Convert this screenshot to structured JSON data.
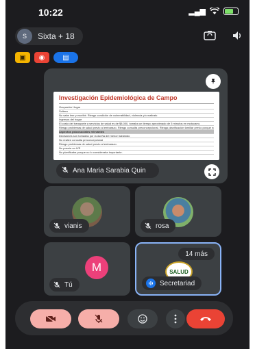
{
  "status_bar": {
    "time": "10:22",
    "signal": "▂▄▆",
    "wifi": "wifi",
    "battery_level": 0.6
  },
  "call": {
    "title": "Sixta + 18",
    "avatar_text": "S"
  },
  "presentation": {
    "doc_title": "Investigación Epidemiológica de Campo",
    "doc_lines": [
      {
        "text": "Ocupación Hogar",
        "highlight": false
      },
      {
        "text": "Soltera",
        "highlight": false
      },
      {
        "text": "No sabe leer y escribir. Riesgo condición de vulnerabilidad, violencia y/o maltrato",
        "highlight": false
      },
      {
        "text": "Ingresos del hogar",
        "highlight": false
      },
      {
        "text": "El costo del transporte a servicios de salud es de $8.000, tomaba un tiempo aproximado de 5 minutos en motocarro.",
        "highlight": false
      },
      {
        "text": "Riesgo problemas de salud previo al embarazo. Riesgo consulta preconcepcional. Riesgo planificación familiar previo porque no lo consideraba importante.",
        "highlight": false
      },
      {
        "text": "Aspectos psicosociales relevantes",
        "highlight": true
      },
      {
        "text": "Decisiones son tomadas por la dueña del menor hablando",
        "highlight": false
      },
      {
        "text": "No realizó consulta preconcepcional",
        "highlight": false
      },
      {
        "text": "Riesgo problemas de salud previo al embarazo.",
        "highlight": false
      },
      {
        "text": "No poseía un IVE",
        "highlight": false
      },
      {
        "text": "No planificaba porque no lo consideraba importante.",
        "highlight": false
      }
    ],
    "presenter_name": "Ana Maria Sarabia Quin"
  },
  "participants": [
    {
      "name": "vianis"
    },
    {
      "name": "rosa"
    },
    {
      "name": "Tú",
      "avatar_letter": "M"
    },
    {
      "name": "Secretariad",
      "more_label": "14 más",
      "logo_text": "SALUD"
    }
  ],
  "icons": {
    "pin": "📌",
    "expand": "⛶",
    "mic_off": "🎙",
    "speaking": "◖",
    "camera_switch": "⟲",
    "speaker": "🔊"
  },
  "colors": {
    "accent": "#1a73e8",
    "hangup": "#ea4335",
    "muted": "#f6aea9",
    "avatar_m": "#ec407a"
  }
}
